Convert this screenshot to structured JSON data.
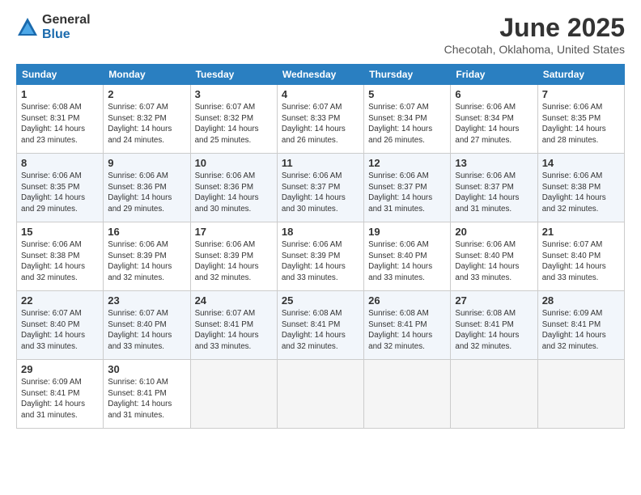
{
  "logo": {
    "general": "General",
    "blue": "Blue"
  },
  "title": "June 2025",
  "location": "Checotah, Oklahoma, United States",
  "headers": [
    "Sunday",
    "Monday",
    "Tuesday",
    "Wednesday",
    "Thursday",
    "Friday",
    "Saturday"
  ],
  "weeks": [
    [
      {
        "day": "1",
        "info": "Sunrise: 6:08 AM\nSunset: 8:31 PM\nDaylight: 14 hours\nand 23 minutes."
      },
      {
        "day": "2",
        "info": "Sunrise: 6:07 AM\nSunset: 8:32 PM\nDaylight: 14 hours\nand 24 minutes."
      },
      {
        "day": "3",
        "info": "Sunrise: 6:07 AM\nSunset: 8:32 PM\nDaylight: 14 hours\nand 25 minutes."
      },
      {
        "day": "4",
        "info": "Sunrise: 6:07 AM\nSunset: 8:33 PM\nDaylight: 14 hours\nand 26 minutes."
      },
      {
        "day": "5",
        "info": "Sunrise: 6:07 AM\nSunset: 8:34 PM\nDaylight: 14 hours\nand 26 minutes."
      },
      {
        "day": "6",
        "info": "Sunrise: 6:06 AM\nSunset: 8:34 PM\nDaylight: 14 hours\nand 27 minutes."
      },
      {
        "day": "7",
        "info": "Sunrise: 6:06 AM\nSunset: 8:35 PM\nDaylight: 14 hours\nand 28 minutes."
      }
    ],
    [
      {
        "day": "8",
        "info": "Sunrise: 6:06 AM\nSunset: 8:35 PM\nDaylight: 14 hours\nand 29 minutes."
      },
      {
        "day": "9",
        "info": "Sunrise: 6:06 AM\nSunset: 8:36 PM\nDaylight: 14 hours\nand 29 minutes."
      },
      {
        "day": "10",
        "info": "Sunrise: 6:06 AM\nSunset: 8:36 PM\nDaylight: 14 hours\nand 30 minutes."
      },
      {
        "day": "11",
        "info": "Sunrise: 6:06 AM\nSunset: 8:37 PM\nDaylight: 14 hours\nand 30 minutes."
      },
      {
        "day": "12",
        "info": "Sunrise: 6:06 AM\nSunset: 8:37 PM\nDaylight: 14 hours\nand 31 minutes."
      },
      {
        "day": "13",
        "info": "Sunrise: 6:06 AM\nSunset: 8:37 PM\nDaylight: 14 hours\nand 31 minutes."
      },
      {
        "day": "14",
        "info": "Sunrise: 6:06 AM\nSunset: 8:38 PM\nDaylight: 14 hours\nand 32 minutes."
      }
    ],
    [
      {
        "day": "15",
        "info": "Sunrise: 6:06 AM\nSunset: 8:38 PM\nDaylight: 14 hours\nand 32 minutes."
      },
      {
        "day": "16",
        "info": "Sunrise: 6:06 AM\nSunset: 8:39 PM\nDaylight: 14 hours\nand 32 minutes."
      },
      {
        "day": "17",
        "info": "Sunrise: 6:06 AM\nSunset: 8:39 PM\nDaylight: 14 hours\nand 32 minutes."
      },
      {
        "day": "18",
        "info": "Sunrise: 6:06 AM\nSunset: 8:39 PM\nDaylight: 14 hours\nand 33 minutes."
      },
      {
        "day": "19",
        "info": "Sunrise: 6:06 AM\nSunset: 8:40 PM\nDaylight: 14 hours\nand 33 minutes."
      },
      {
        "day": "20",
        "info": "Sunrise: 6:06 AM\nSunset: 8:40 PM\nDaylight: 14 hours\nand 33 minutes."
      },
      {
        "day": "21",
        "info": "Sunrise: 6:07 AM\nSunset: 8:40 PM\nDaylight: 14 hours\nand 33 minutes."
      }
    ],
    [
      {
        "day": "22",
        "info": "Sunrise: 6:07 AM\nSunset: 8:40 PM\nDaylight: 14 hours\nand 33 minutes."
      },
      {
        "day": "23",
        "info": "Sunrise: 6:07 AM\nSunset: 8:40 PM\nDaylight: 14 hours\nand 33 minutes."
      },
      {
        "day": "24",
        "info": "Sunrise: 6:07 AM\nSunset: 8:41 PM\nDaylight: 14 hours\nand 33 minutes."
      },
      {
        "day": "25",
        "info": "Sunrise: 6:08 AM\nSunset: 8:41 PM\nDaylight: 14 hours\nand 32 minutes."
      },
      {
        "day": "26",
        "info": "Sunrise: 6:08 AM\nSunset: 8:41 PM\nDaylight: 14 hours\nand 32 minutes."
      },
      {
        "day": "27",
        "info": "Sunrise: 6:08 AM\nSunset: 8:41 PM\nDaylight: 14 hours\nand 32 minutes."
      },
      {
        "day": "28",
        "info": "Sunrise: 6:09 AM\nSunset: 8:41 PM\nDaylight: 14 hours\nand 32 minutes."
      }
    ],
    [
      {
        "day": "29",
        "info": "Sunrise: 6:09 AM\nSunset: 8:41 PM\nDaylight: 14 hours\nand 31 minutes."
      },
      {
        "day": "30",
        "info": "Sunrise: 6:10 AM\nSunset: 8:41 PM\nDaylight: 14 hours\nand 31 minutes."
      },
      {
        "day": "",
        "info": ""
      },
      {
        "day": "",
        "info": ""
      },
      {
        "day": "",
        "info": ""
      },
      {
        "day": "",
        "info": ""
      },
      {
        "day": "",
        "info": ""
      }
    ]
  ]
}
